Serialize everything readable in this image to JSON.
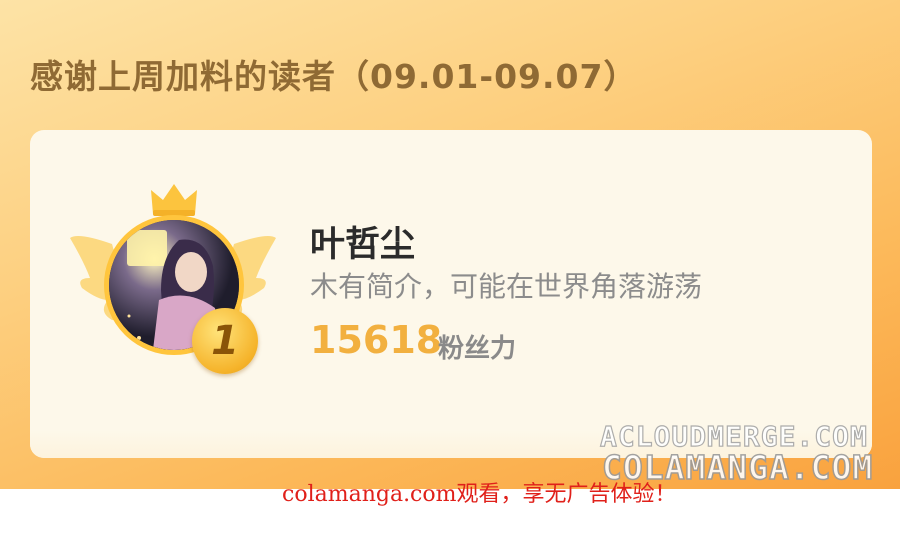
{
  "header": {
    "title": "感谢上周加料的读者（09.01-09.07）"
  },
  "reader": {
    "rank": "1",
    "name": "叶哲尘",
    "bio": "木有简介，可能在世界角落游荡",
    "fans_value": "15618",
    "fans_label": "粉丝力"
  },
  "watermarks": {
    "line1": "ACLOUDMERGE.COM",
    "line2": "COLAMANGA.COM",
    "promo": "colamanga.com观看，享无广告体验！"
  },
  "colors": {
    "banner_orange": "#fcb95a",
    "card_bg": "#fdf8ea",
    "title_text": "#8f6a34",
    "fans_value": "#f2b03f",
    "medal_gold": "#ffc53d",
    "promo_red": "#e0201a"
  },
  "icons": [
    "crown-icon",
    "wings-icon",
    "rank-medal-icon"
  ]
}
